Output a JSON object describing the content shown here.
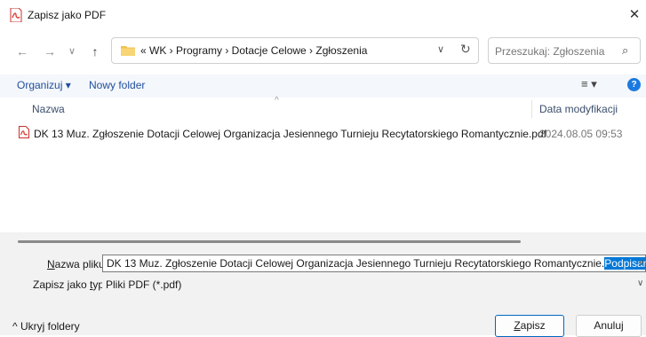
{
  "window": {
    "title": "Zapisz jako PDF",
    "close_glyph": "✕"
  },
  "nav": {
    "back": "←",
    "forward": "→",
    "recent": "∨",
    "up": "↑",
    "breadcrumb": "«  WK  ›  Programy  ›  Dotacje Celowe  ›  Zgłoszenia",
    "address_dropdown": "∨",
    "refresh": "↻",
    "search_placeholder": "Przeszukaj: Zgłoszenia",
    "search_glyph": "⌕"
  },
  "toolbar": {
    "organize": "Organizuj ▾",
    "new_folder": "Nowy folder",
    "view": "≡ ▾",
    "help": "?"
  },
  "list": {
    "columns": {
      "name": "Nazwa",
      "date": "Data modyfikacji"
    },
    "sort_glyph": "^",
    "files": [
      {
        "name": "DK 13 Muz. Zgłoszenie Dotacji Celowej Organizacja Jesiennego Turnieju Recytatorskiego Romantycznie.pdf",
        "date": "2024.08.05 09:53",
        "icon": "pdf-icon"
      }
    ]
  },
  "form": {
    "filename_label_pre": "N",
    "filename_label_rest": "azwa pliku:",
    "filename_value": "DK 13 Muz. Zgłoszenie Dotacji Celowej Organizacja Jesiennego Turnieju Recytatorskiego Romantycznie.",
    "filename_selected": "Podpisany",
    "type_label_pre": "Zapisz jako ",
    "type_label_ul": "t",
    "type_label_rest": "yp:",
    "type_value": "Pliki PDF (*.pdf)",
    "dropdown_glyph": "∨"
  },
  "footer": {
    "hide_folders": "^  Ukryj foldery",
    "save_pre": "",
    "save_ul": "Z",
    "save_rest": "apisz",
    "cancel": "Anuluj"
  },
  "colors": {
    "accent": "#0078d7",
    "link": "#1f4e9c",
    "pdf_red": "#d9362b"
  }
}
